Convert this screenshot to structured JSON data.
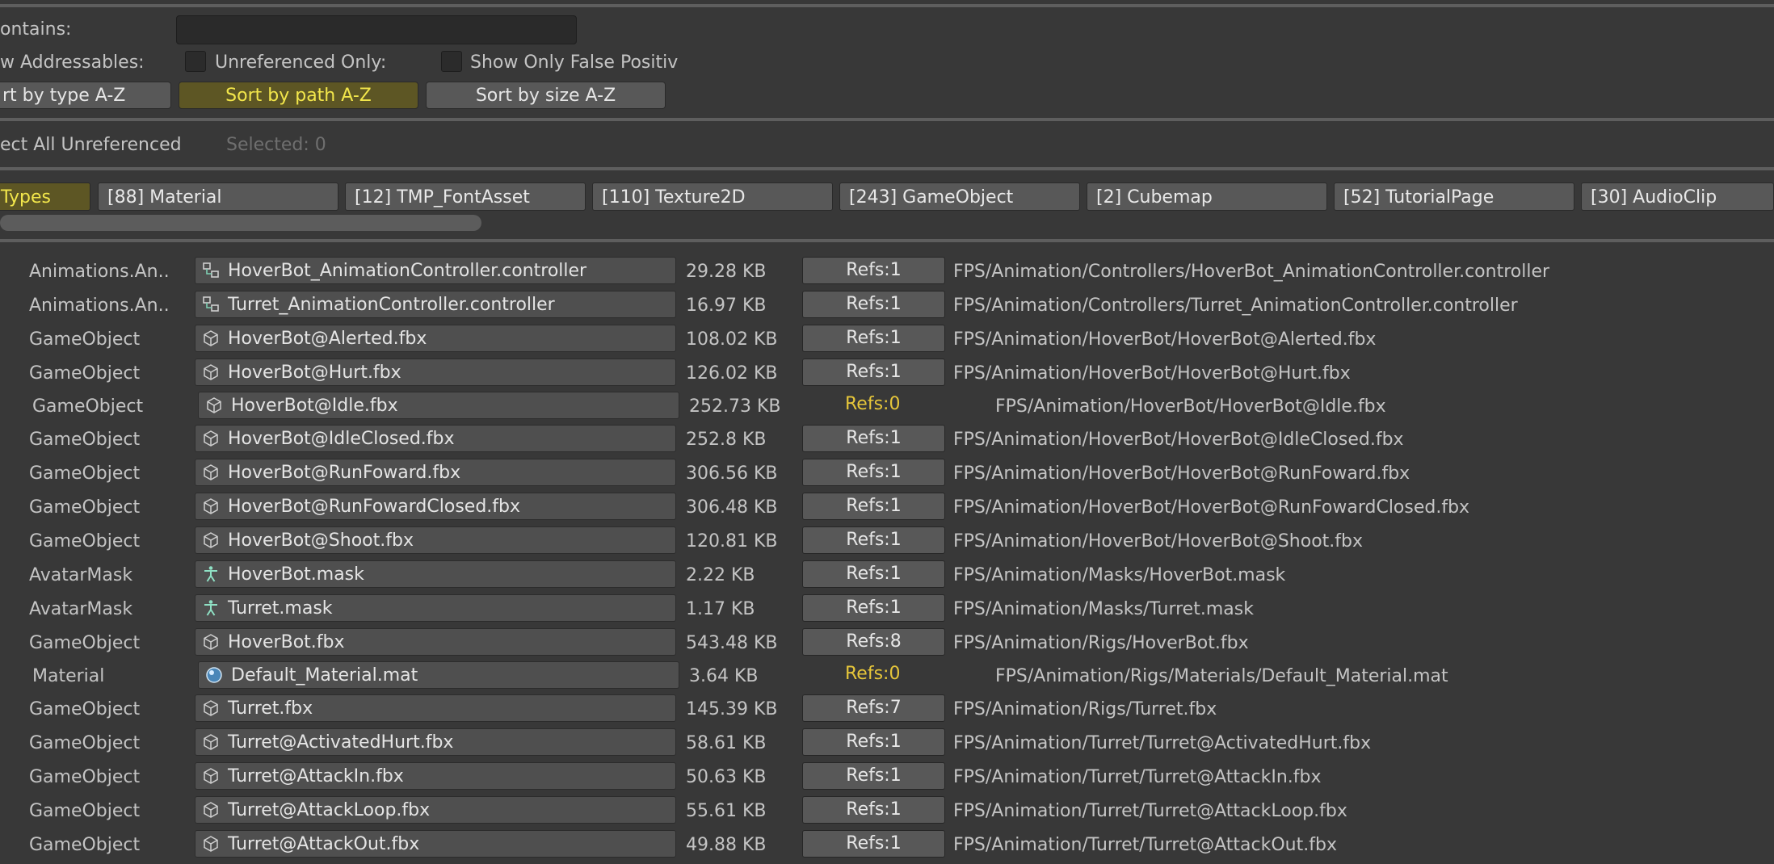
{
  "filters": {
    "contains_label": "ontains:",
    "contains_value": "",
    "show_addressables_label": "w Addressables:",
    "unreferenced_only_label": "Unreferenced Only:",
    "show_false_positive_label": "Show Only False Positiv"
  },
  "sort": {
    "by_type": "rt by type A-Z",
    "by_path": "Sort by path A-Z",
    "by_size": "Sort by size A-Z",
    "active": "by_path"
  },
  "selection": {
    "select_all_label": "ect All Unreferenced",
    "selected_label": "Selected: 0"
  },
  "type_tabs": [
    {
      "label": "Types",
      "active": true
    },
    {
      "label": "[88] Material"
    },
    {
      "label": "[12] TMP_FontAsset"
    },
    {
      "label": "[110] Texture2D"
    },
    {
      "label": "[243] GameObject"
    },
    {
      "label": "[2] Cubemap"
    },
    {
      "label": "[52] TutorialPage"
    },
    {
      "label": "[30] AudioClip"
    }
  ],
  "colors": {
    "background": "#383838",
    "active_toggle_bg": "#5d5624",
    "active_toggle_text": "#f2e64b",
    "zero_refs_text": "#e6c63a"
  },
  "rows": [
    {
      "type": "Animations.An..",
      "icon": "animator-controller-icon",
      "name": "HoverBot_AnimationController.controller",
      "size": "29.28 KB",
      "refs": "Refs:1",
      "path": "FPS/Animation/Controllers/HoverBot_AnimationController.controller"
    },
    {
      "type": "Animations.An..",
      "icon": "animator-controller-icon",
      "name": "Turret_AnimationController.controller",
      "size": "16.97 KB",
      "refs": "Refs:1",
      "path": "FPS/Animation/Controllers/Turret_AnimationController.controller"
    },
    {
      "type": "GameObject",
      "icon": "model-cube-icon",
      "name": "HoverBot@Alerted.fbx",
      "size": "108.02 KB",
      "refs": "Refs:1",
      "path": "FPS/Animation/HoverBot/HoverBot@Alerted.fbx"
    },
    {
      "type": "GameObject",
      "icon": "model-cube-icon",
      "name": "HoverBot@Hurt.fbx",
      "size": "126.02 KB",
      "refs": "Refs:1",
      "path": "FPS/Animation/HoverBot/HoverBot@Hurt.fbx"
    },
    {
      "type": "GameObject",
      "icon": "model-cube-icon",
      "name": "HoverBot@Idle.fbx",
      "size": "252.73 KB",
      "refs": "Refs:0",
      "path": "FPS/Animation/HoverBot/HoverBot@Idle.fbx",
      "zero": true
    },
    {
      "type": "GameObject",
      "icon": "model-cube-icon",
      "name": "HoverBot@IdleClosed.fbx",
      "size": "252.8 KB",
      "refs": "Refs:1",
      "path": "FPS/Animation/HoverBot/HoverBot@IdleClosed.fbx"
    },
    {
      "type": "GameObject",
      "icon": "model-cube-icon",
      "name": "HoverBot@RunFoward.fbx",
      "size": "306.56 KB",
      "refs": "Refs:1",
      "path": "FPS/Animation/HoverBot/HoverBot@RunFoward.fbx"
    },
    {
      "type": "GameObject",
      "icon": "model-cube-icon",
      "name": "HoverBot@RunFowardClosed.fbx",
      "size": "306.48 KB",
      "refs": "Refs:1",
      "path": "FPS/Animation/HoverBot/HoverBot@RunFowardClosed.fbx"
    },
    {
      "type": "GameObject",
      "icon": "model-cube-icon",
      "name": "HoverBot@Shoot.fbx",
      "size": "120.81 KB",
      "refs": "Refs:1",
      "path": "FPS/Animation/HoverBot/HoverBot@Shoot.fbx"
    },
    {
      "type": "AvatarMask",
      "icon": "avatar-mask-icon",
      "name": "HoverBot.mask",
      "size": "2.22 KB",
      "refs": "Refs:1",
      "path": "FPS/Animation/Masks/HoverBot.mask"
    },
    {
      "type": "AvatarMask",
      "icon": "avatar-mask-icon",
      "name": "Turret.mask",
      "size": "1.17 KB",
      "refs": "Refs:1",
      "path": "FPS/Animation/Masks/Turret.mask"
    },
    {
      "type": "GameObject",
      "icon": "model-cube-icon",
      "name": "HoverBot.fbx",
      "size": "543.48 KB",
      "refs": "Refs:8",
      "path": "FPS/Animation/Rigs/HoverBot.fbx"
    },
    {
      "type": "Material",
      "icon": "material-sphere-icon",
      "name": "Default_Material.mat",
      "size": "3.64 KB",
      "refs": "Refs:0",
      "path": "FPS/Animation/Rigs/Materials/Default_Material.mat",
      "zero": true
    },
    {
      "type": "GameObject",
      "icon": "model-cube-icon",
      "name": "Turret.fbx",
      "size": "145.39 KB",
      "refs": "Refs:7",
      "path": "FPS/Animation/Rigs/Turret.fbx"
    },
    {
      "type": "GameObject",
      "icon": "model-cube-icon",
      "name": "Turret@ActivatedHurt.fbx",
      "size": "58.61 KB",
      "refs": "Refs:1",
      "path": "FPS/Animation/Turret/Turret@ActivatedHurt.fbx"
    },
    {
      "type": "GameObject",
      "icon": "model-cube-icon",
      "name": "Turret@AttackIn.fbx",
      "size": "50.63 KB",
      "refs": "Refs:1",
      "path": "FPS/Animation/Turret/Turret@AttackIn.fbx"
    },
    {
      "type": "GameObject",
      "icon": "model-cube-icon",
      "name": "Turret@AttackLoop.fbx",
      "size": "55.61 KB",
      "refs": "Refs:1",
      "path": "FPS/Animation/Turret/Turret@AttackLoop.fbx"
    },
    {
      "type": "GameObject",
      "icon": "model-cube-icon",
      "name": "Turret@AttackOut.fbx",
      "size": "49.88 KB",
      "refs": "Refs:1",
      "path": "FPS/Animation/Turret/Turret@AttackOut.fbx"
    }
  ]
}
